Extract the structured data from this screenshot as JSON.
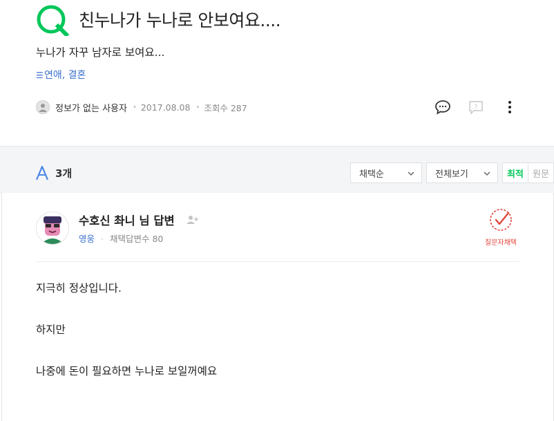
{
  "question": {
    "title": "친누나가 누나로 안보여요....",
    "body": "누나가 자꾸 남자로 보여요...",
    "category": "연애, 결혼",
    "author": "정보가 없는 사용자",
    "date": "2017.08.08",
    "views_label": "조회수 287"
  },
  "answers_header": {
    "count": "3개",
    "sort_select": "채택순",
    "filter_select": "전체보기",
    "tab_latest": "최적",
    "tab_original": "원문"
  },
  "answer": {
    "name": "수호신 촤니 님 답변",
    "grade": "영웅",
    "adopted_count": "채택답변수 80",
    "badge_label": "질문자채택",
    "lines": [
      "지극히 정상입니다.",
      "하지만",
      "나중에 돈이 필요하면 누나로 보일꺼예요"
    ]
  },
  "colors": {
    "accent_green": "#03c75a",
    "category_blue": "#3a6fcd",
    "badge_red": "#e2463c"
  }
}
